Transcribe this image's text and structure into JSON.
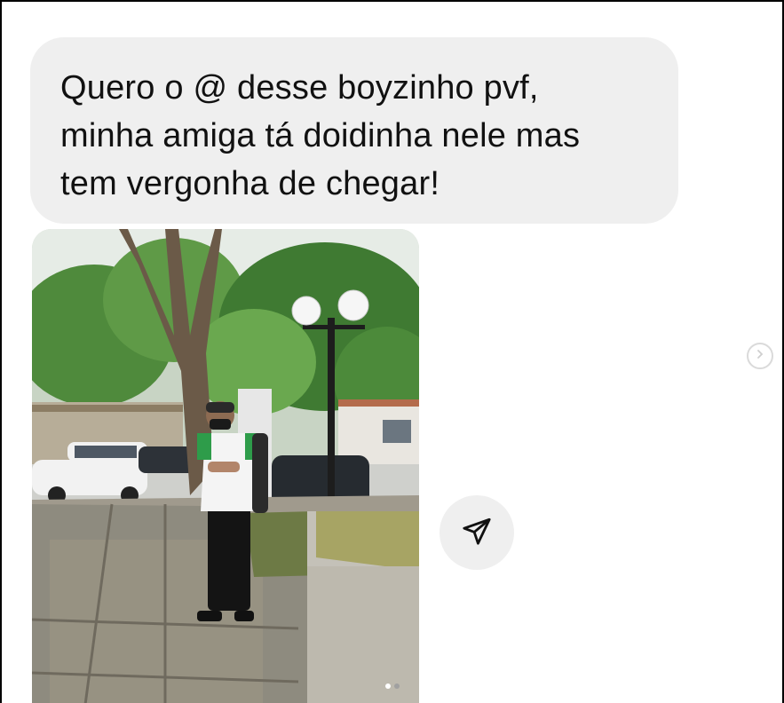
{
  "message": {
    "text": "Quero o @ desse boyzinho pvf,\nminha amiga tá doidinha nele mas\ntem vergonha de chegar!"
  },
  "photo": {
    "icon": "photo-attachment"
  },
  "actions": {
    "share_icon": "paper-plane-icon",
    "next_icon": "chevron-right-icon"
  },
  "carousel": {
    "total": 2,
    "active": 1
  },
  "colors": {
    "bubble_bg": "#efefef",
    "text": "#111111",
    "dot_active": "#ffffff",
    "dot_inactive": "#a0a0a0"
  }
}
